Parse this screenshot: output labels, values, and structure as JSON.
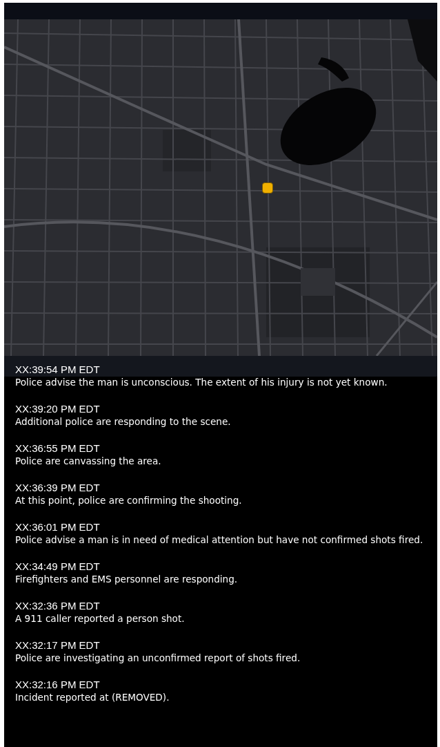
{
  "updates": [
    {
      "time": "XX:39:54 PM EDT",
      "text": "Police advise the man is unconscious. The extent of his injury is not yet known."
    },
    {
      "time": "XX:39:20 PM EDT",
      "text": "Additional police are responding to the scene."
    },
    {
      "time": "XX:36:55 PM EDT",
      "text": "Police are canvassing the area."
    },
    {
      "time": "XX:36:39 PM EDT",
      "text": "At this point, police are confirming the shooting."
    },
    {
      "time": "XX:36:01 PM EDT",
      "text": "Police advise a man is in need of medical attention but have not confirmed shots fired."
    },
    {
      "time": "XX:34:49 PM EDT",
      "text": "Firefighters and EMS personnel are responding."
    },
    {
      "time": "XX:32:36 PM EDT",
      "text": "A 911 caller reported a person shot."
    },
    {
      "time": "XX:32:17 PM EDT",
      "text": "Police are investigating an unconfirmed report of shots fired."
    },
    {
      "time": "XX:32:16 PM EDT",
      "text": "Incident reported at (REMOVED)."
    }
  ]
}
